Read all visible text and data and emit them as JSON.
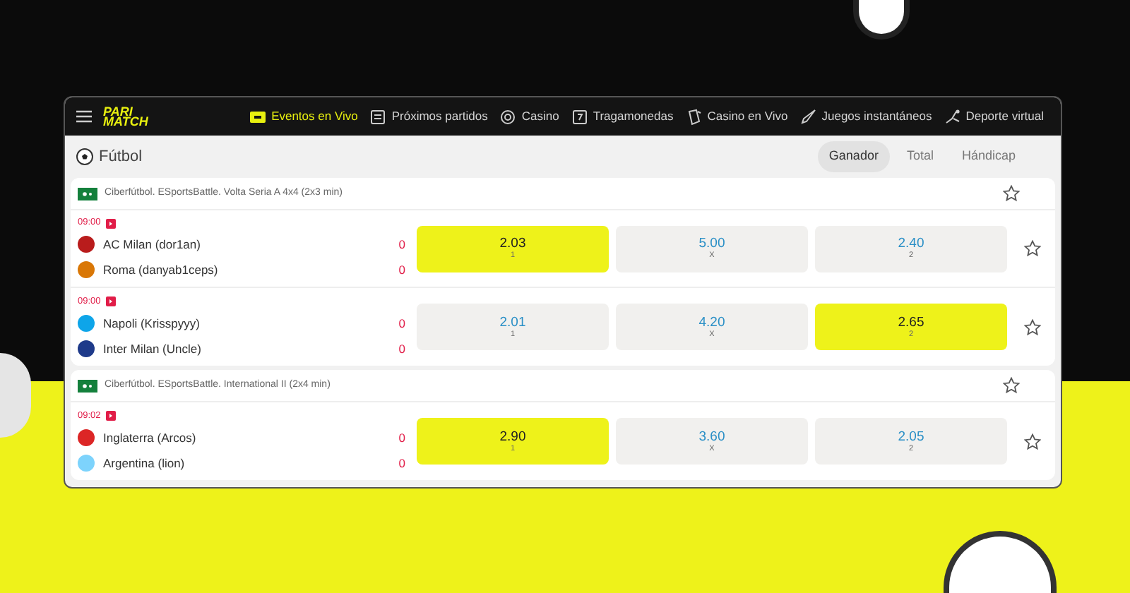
{
  "nav": {
    "logo_top": "PARI",
    "logo_bottom": "MATCH",
    "items": [
      {
        "label": "Eventos en Vivo",
        "selected": true
      },
      {
        "label": "Próximos partidos",
        "selected": false
      },
      {
        "label": "Casino",
        "selected": false
      },
      {
        "label": "Tragamonedas",
        "selected": false
      },
      {
        "label": "Casino en Vivo",
        "selected": false
      },
      {
        "label": "Juegos instantáneos",
        "selected": false
      },
      {
        "label": "Deporte virtual",
        "selected": false
      }
    ]
  },
  "sport": {
    "title": "Fútbol",
    "markets": [
      {
        "label": "Ganador",
        "selected": true
      },
      {
        "label": "Total",
        "selected": false
      },
      {
        "label": "Hándicap",
        "selected": false
      }
    ]
  },
  "leagues": [
    {
      "title": "Ciberfútbol. ESportsBattle. Volta Seria A 4x4 (2x3 min)",
      "favorite": false,
      "matches": [
        {
          "time": "09:00",
          "favorite": false,
          "teams": [
            {
              "name": "AC Milan (dor1an)",
              "score": "0",
              "color": "#b91c1c"
            },
            {
              "name": "Roma (danyab1ceps)",
              "score": "0",
              "color": "#d97706"
            }
          ],
          "odds": [
            {
              "value": "2.03",
              "label": "1",
              "selected": true
            },
            {
              "value": "5.00",
              "label": "X",
              "selected": false
            },
            {
              "value": "2.40",
              "label": "2",
              "selected": false
            }
          ]
        },
        {
          "time": "09:00",
          "favorite": false,
          "teams": [
            {
              "name": "Napoli (Krisspyyy)",
              "score": "0",
              "color": "#0ea5e9"
            },
            {
              "name": "Inter Milan (Uncle)",
              "score": "0",
              "color": "#1e3a8a"
            }
          ],
          "odds": [
            {
              "value": "2.01",
              "label": "1",
              "selected": false
            },
            {
              "value": "4.20",
              "label": "X",
              "selected": false
            },
            {
              "value": "2.65",
              "label": "2",
              "selected": true
            }
          ]
        }
      ]
    },
    {
      "title": "Ciberfútbol. ESportsBattle. International II (2x4 min)",
      "favorite": false,
      "matches": [
        {
          "time": "09:02",
          "favorite": false,
          "teams": [
            {
              "name": "Inglaterra (Arcos)",
              "score": "0",
              "color": "#dc2626"
            },
            {
              "name": "Argentina (lion)",
              "score": "0",
              "color": "#7dd3fc"
            }
          ],
          "odds": [
            {
              "value": "2.90",
              "label": "1",
              "selected": true
            },
            {
              "value": "3.60",
              "label": "X",
              "selected": false
            },
            {
              "value": "2.05",
              "label": "2",
              "selected": false
            }
          ]
        }
      ]
    }
  ]
}
